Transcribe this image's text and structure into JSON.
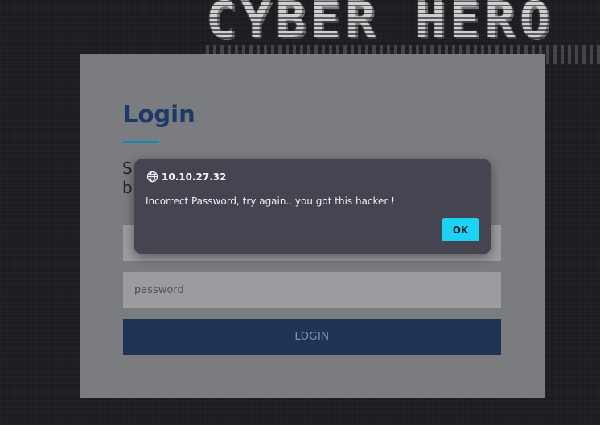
{
  "banner": {
    "text": "CYBER HERO"
  },
  "login_card": {
    "title": "Login",
    "subtitle_line1": "S",
    "subtitle_line2": "b",
    "username_value": "",
    "password_placeholder": "password",
    "login_button_label": "LOGIN"
  },
  "alert_dialog": {
    "origin": "10.10.27.32",
    "message": "Incorrect Password, try again.. you got this hacker !",
    "ok_label": "OK",
    "icon": "globe-icon"
  },
  "colors": {
    "page_background": "#1b1c20",
    "card_background": "#7b7c80",
    "title": "#1d3a66",
    "accent_underline": "#1789b0",
    "login_button": "#1f3456",
    "dialog_background": "#454450",
    "ok_button": "#1ad3f5"
  }
}
